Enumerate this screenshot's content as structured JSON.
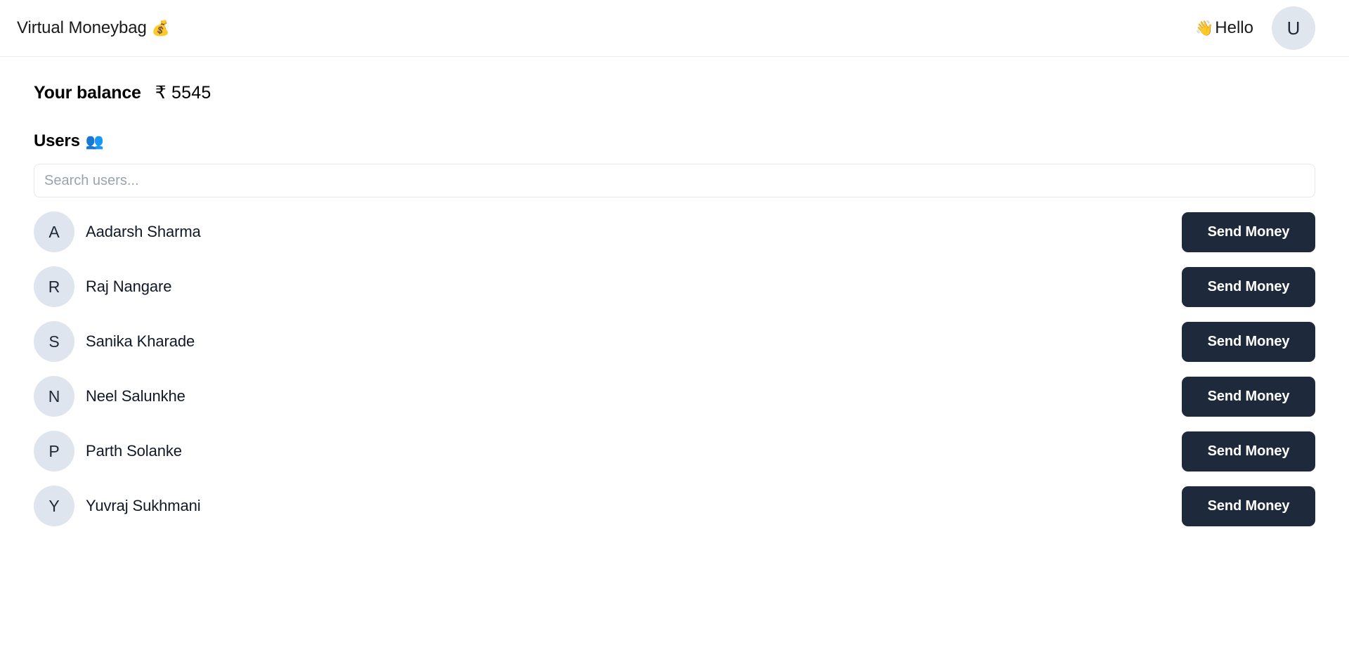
{
  "header": {
    "brand_title": "Virtual Moneybag",
    "brand_emoji": "💰",
    "greeting_emoji": "👋",
    "greeting_text": "Hello",
    "avatar_initial": "U"
  },
  "balance": {
    "label": "Your balance",
    "value": "₹ 5545"
  },
  "users_section": {
    "heading": "Users",
    "heading_emoji": "👥",
    "search_placeholder": "Search users...",
    "search_value": ""
  },
  "users": [
    {
      "initial": "A",
      "name": "Aadarsh Sharma",
      "action_label": "Send Money"
    },
    {
      "initial": "R",
      "name": "Raj Nangare",
      "action_label": "Send Money"
    },
    {
      "initial": "S",
      "name": "Sanika Kharade",
      "action_label": "Send Money"
    },
    {
      "initial": "N",
      "name": "Neel Salunkhe",
      "action_label": "Send Money"
    },
    {
      "initial": "P",
      "name": "Parth Solanke",
      "action_label": "Send Money"
    },
    {
      "initial": "Y",
      "name": "Yuvraj Sukhmani",
      "action_label": "Send Money"
    }
  ],
  "colors": {
    "page_background": "#ffffff",
    "header_border": "#e9ecef",
    "avatar_background": "#dee5ee",
    "button_background": "#1e293b",
    "button_text": "#ffffff",
    "input_border": "#e3e8ef",
    "placeholder_text": "#9aa3af",
    "primary_text": "#111827"
  }
}
